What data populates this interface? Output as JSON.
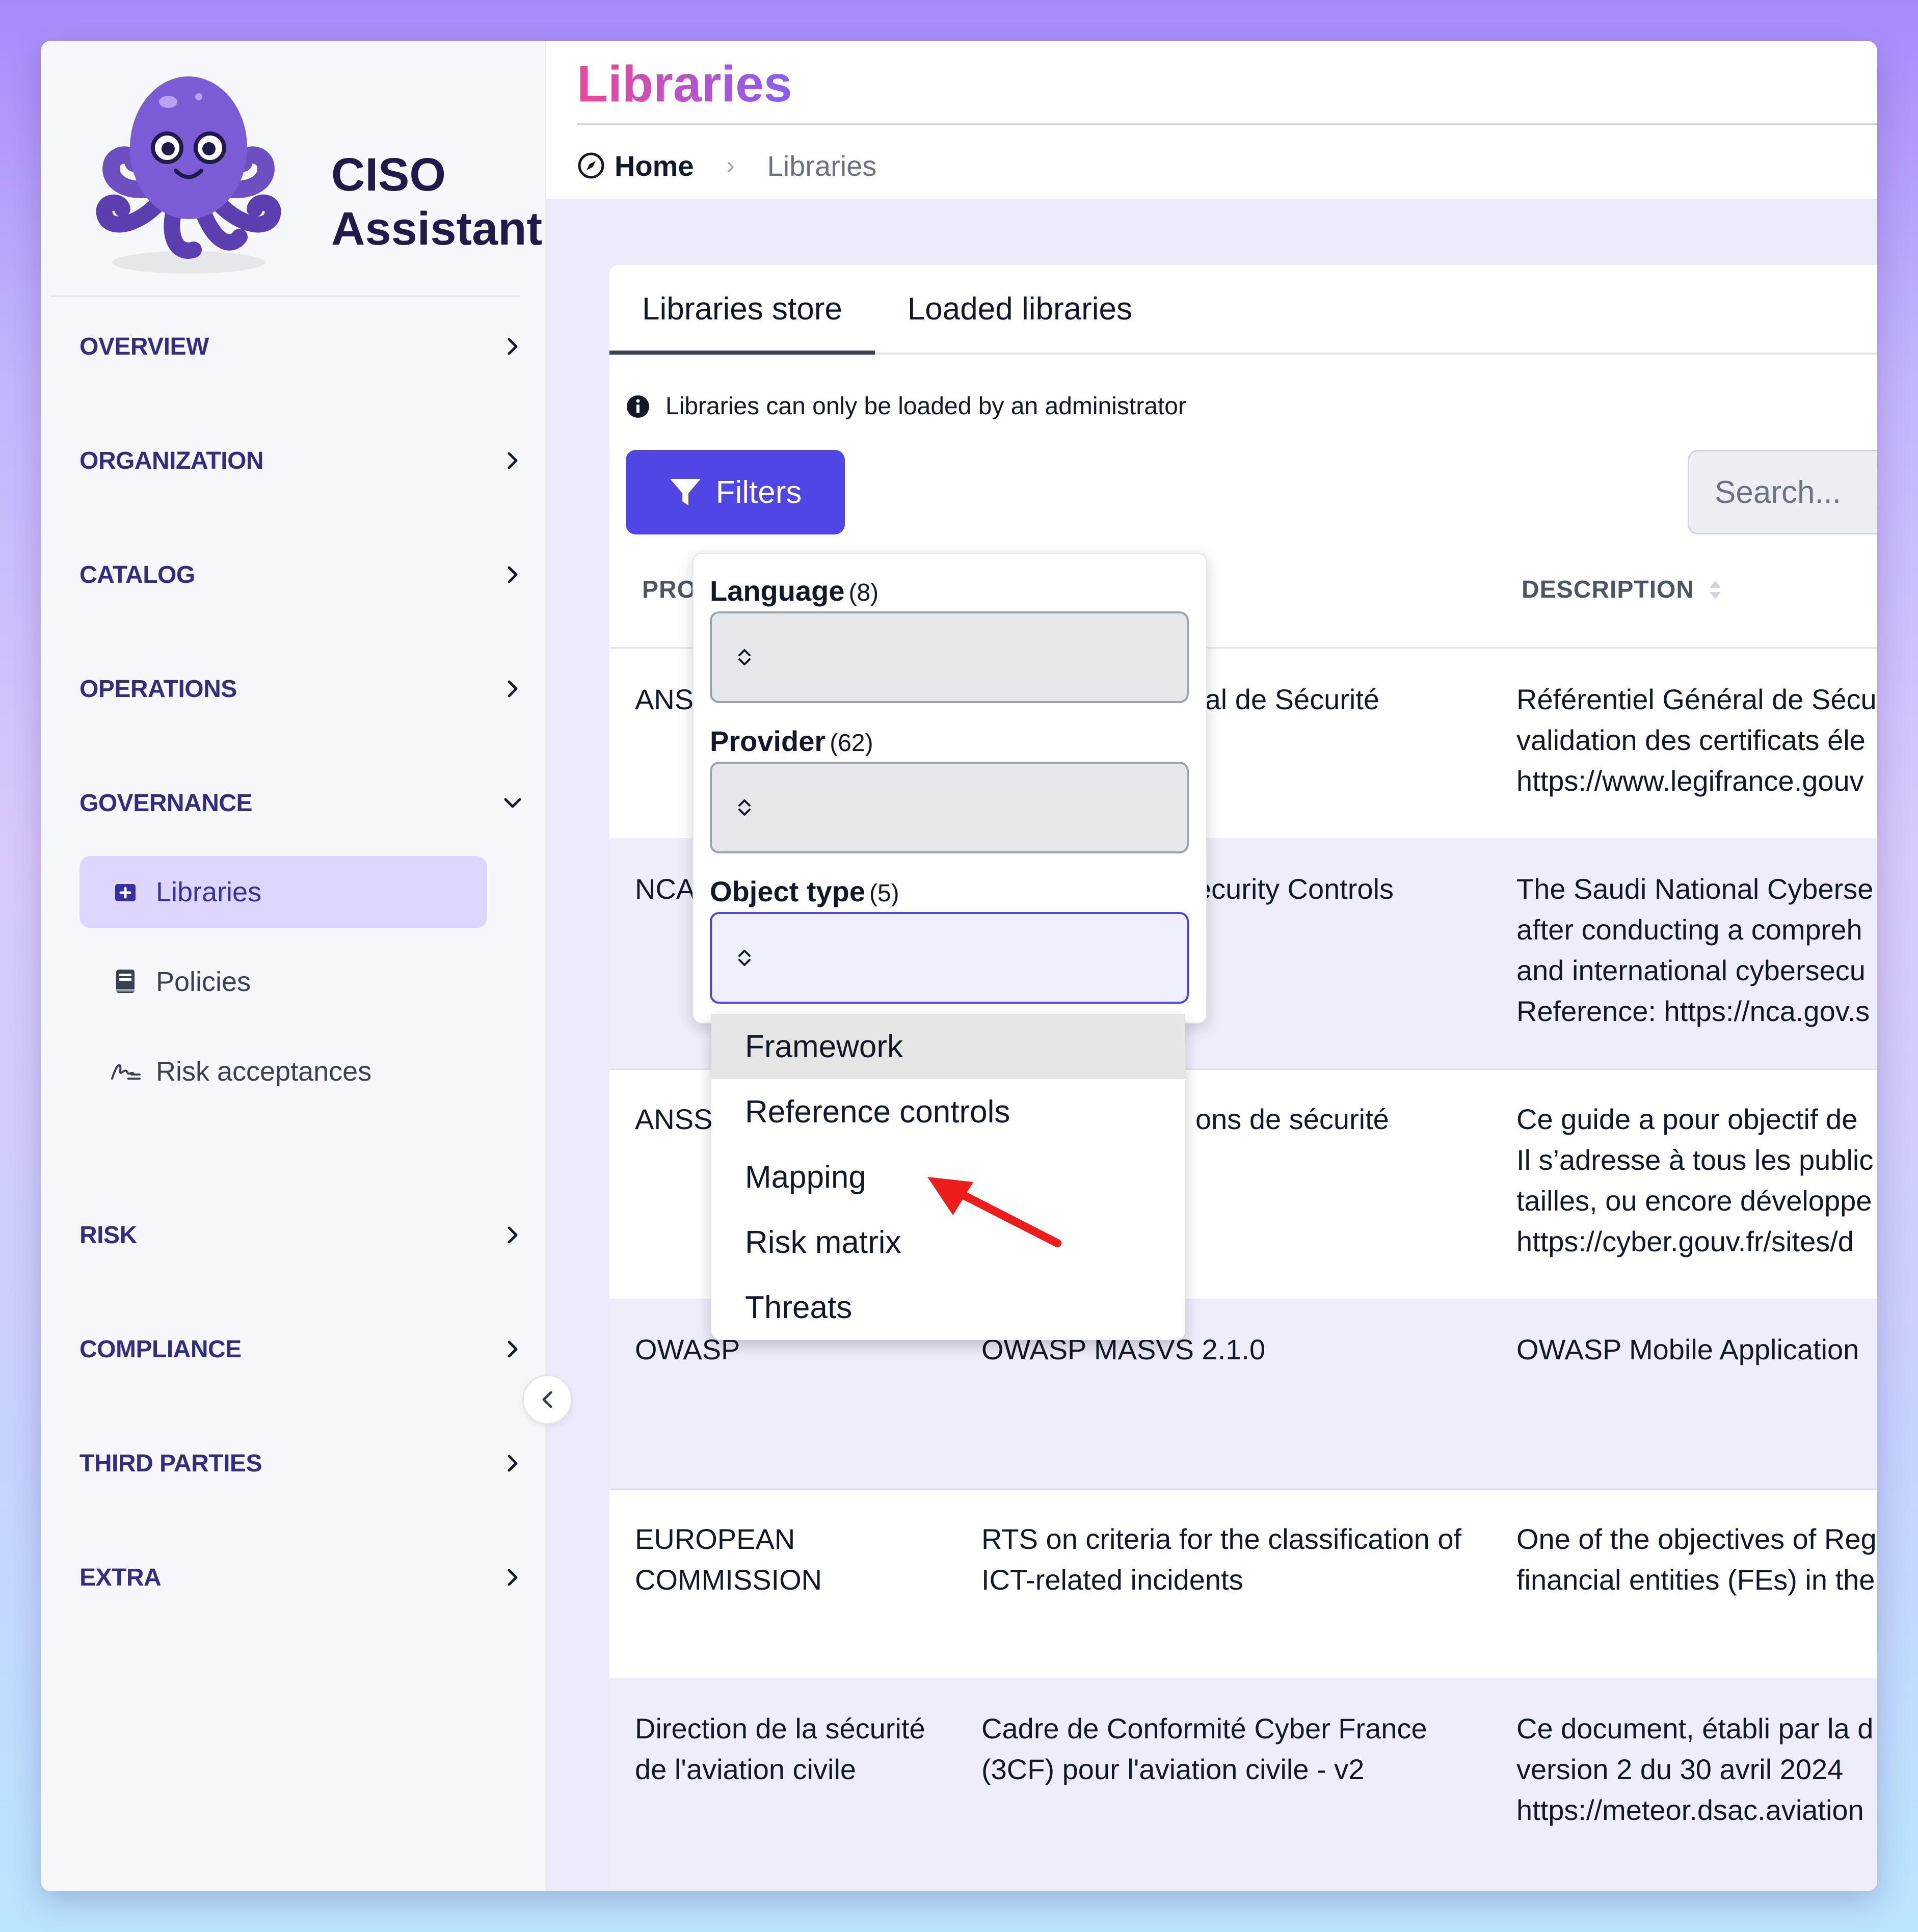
{
  "app": {
    "name_line1": "CISO",
    "name_line2": "Assistant"
  },
  "sidebar": {
    "sections": [
      {
        "label": "OVERVIEW",
        "expanded": false
      },
      {
        "label": "ORGANIZATION",
        "expanded": false
      },
      {
        "label": "CATALOG",
        "expanded": false
      },
      {
        "label": "OPERATIONS",
        "expanded": false
      },
      {
        "label": "GOVERNANCE",
        "expanded": true
      },
      {
        "label": "RISK",
        "expanded": false
      },
      {
        "label": "COMPLIANCE",
        "expanded": false
      },
      {
        "label": "THIRD PARTIES",
        "expanded": false
      },
      {
        "label": "EXTRA",
        "expanded": false
      }
    ],
    "governance_items": [
      {
        "label": "Libraries",
        "icon": "library-add-icon",
        "active": true
      },
      {
        "label": "Policies",
        "icon": "book-icon",
        "active": false
      },
      {
        "label": "Risk acceptances",
        "icon": "signature-icon",
        "active": false
      }
    ]
  },
  "header": {
    "title": "Libraries",
    "breadcrumb": {
      "home": "Home",
      "current": "Libraries"
    }
  },
  "tabs": [
    {
      "label": "Libraries store",
      "active": true
    },
    {
      "label": "Loaded libraries",
      "active": false
    }
  ],
  "notice": "Libraries can only be loaded by an administrator",
  "filters_button": "Filters",
  "search": {
    "placeholder": "Search..."
  },
  "table": {
    "columns": [
      "PRO",
      "DESCRIPTION"
    ],
    "rows": [
      {
        "provider": "ANS",
        "name": "ral de Sécurité",
        "description": [
          "Référentiel Général de Sécu",
          "validation des certificats éle",
          "https://www.legifrance.gouv"
        ]
      },
      {
        "provider": "NCA",
        "name": "ecurity Controls",
        "description": [
          "The Saudi National Cyberse",
          "after conducting a compreh",
          "and international cybersecu",
          "Reference: https://nca.gov.s"
        ]
      },
      {
        "provider": "ANSS",
        "name": "ons de sécurité",
        "description": [
          "Ce guide a pour objectif de",
          "Il s’adresse à tous les public",
          "tailles, ou encore développe",
          "https://cyber.gouv.fr/sites/d"
        ]
      },
      {
        "provider": "OWASP",
        "name": "OWASP MASVS 2.1.0",
        "description": [
          "OWASP Mobile Application"
        ]
      },
      {
        "provider": "EUROPEAN COMMISSION",
        "name": "RTS on criteria for the classification of ICT-related incidents",
        "description": [
          "One of the objectives of Reg",
          "financial entities (FEs) in the"
        ]
      },
      {
        "provider": "Direction de la sécurité de l'aviation civile",
        "name": "Cadre de Conformité Cyber France (3CF) pour l'aviation civile - v2",
        "description": [
          "Ce document, établi par la d",
          "version 2 du 30 avril 2024",
          "https://meteor.dsac.aviation"
        ]
      }
    ]
  },
  "filter_panel": {
    "language": {
      "label": "Language",
      "count": "(8)"
    },
    "provider": {
      "label": "Provider",
      "count": "(62)"
    },
    "object_type": {
      "label": "Object type",
      "count": "(5)"
    },
    "object_type_options": [
      "Framework",
      "Reference controls",
      "Mapping",
      "Risk matrix",
      "Threats"
    ],
    "highlighted_option": "Framework"
  },
  "colors": {
    "accent": "#4f46e5",
    "nav_text": "#312e81",
    "active_bg": "#ddd6fe",
    "arrow": "#ef1c1c"
  }
}
